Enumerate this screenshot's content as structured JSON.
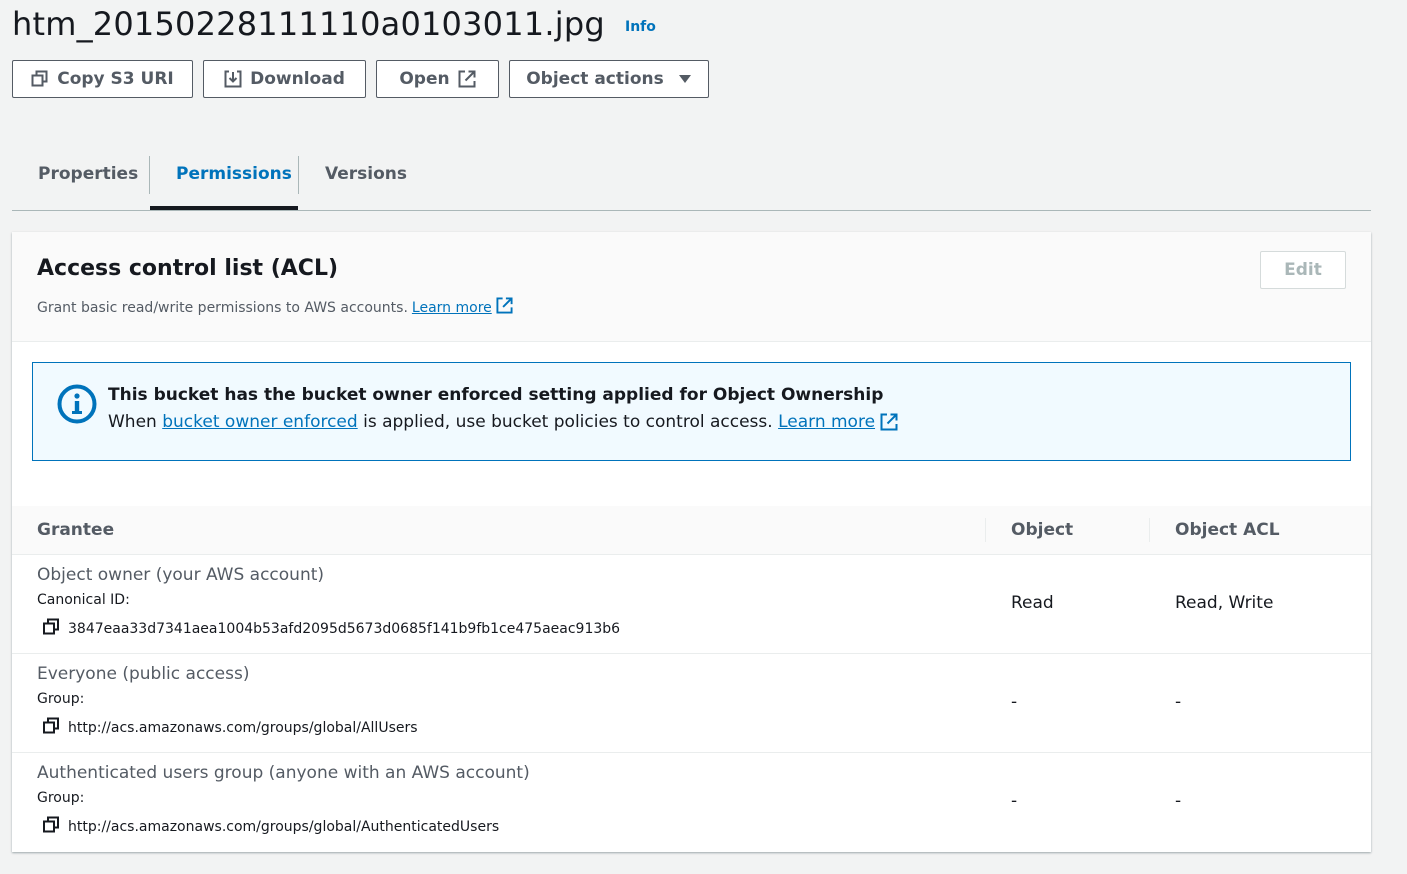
{
  "header": {
    "title": "htm_20150228111110a0103011.jpg",
    "info_label": "Info"
  },
  "actions": {
    "copy_s3_uri": "Copy S3 URI",
    "download": "Download",
    "open": "Open",
    "object_actions": "Object actions"
  },
  "tabs": [
    {
      "label": "Properties",
      "active": false
    },
    {
      "label": "Permissions",
      "active": true
    },
    {
      "label": "Versions",
      "active": false
    }
  ],
  "acl": {
    "title": "Access control list (ACL)",
    "description": "Grant basic read/write permissions to AWS accounts.",
    "learn_more": "Learn more",
    "edit_label": "Edit",
    "alert": {
      "title": "This bucket has the bucket owner enforced setting applied for Object Ownership",
      "body_prefix": "When ",
      "body_link": "bucket owner enforced",
      "body_suffix": " is applied, use bucket policies to control access. ",
      "learn_more": "Learn more"
    },
    "columns": [
      "Grantee",
      "Object",
      "Object ACL"
    ],
    "rows": [
      {
        "grantee": "Object owner (your AWS account)",
        "sub_label": "Canonical ID:",
        "identifier": "3847eaa33d7341aea1004b53afd2095d5673d0685f141b9fb1ce475aeac913b6",
        "object": "Read",
        "object_acl": "Read, Write"
      },
      {
        "grantee": "Everyone (public access)",
        "sub_label": "Group:",
        "identifier": "http://acs.amazonaws.com/groups/global/AllUsers",
        "object": "-",
        "object_acl": "-"
      },
      {
        "grantee": "Authenticated users group (anyone with an AWS account)",
        "sub_label": "Group:",
        "identifier": "http://acs.amazonaws.com/groups/global/AuthenticatedUsers",
        "object": "-",
        "object_acl": "-"
      }
    ]
  },
  "colors": {
    "link": "#0073bb",
    "text": "#16191f",
    "muted": "#545b64",
    "border": "#aab7b8",
    "alert_bg": "#f1faff"
  },
  "icons": [
    "copy-icon",
    "download-icon",
    "external-link-icon",
    "caret-down-icon",
    "info-circle-icon"
  ]
}
